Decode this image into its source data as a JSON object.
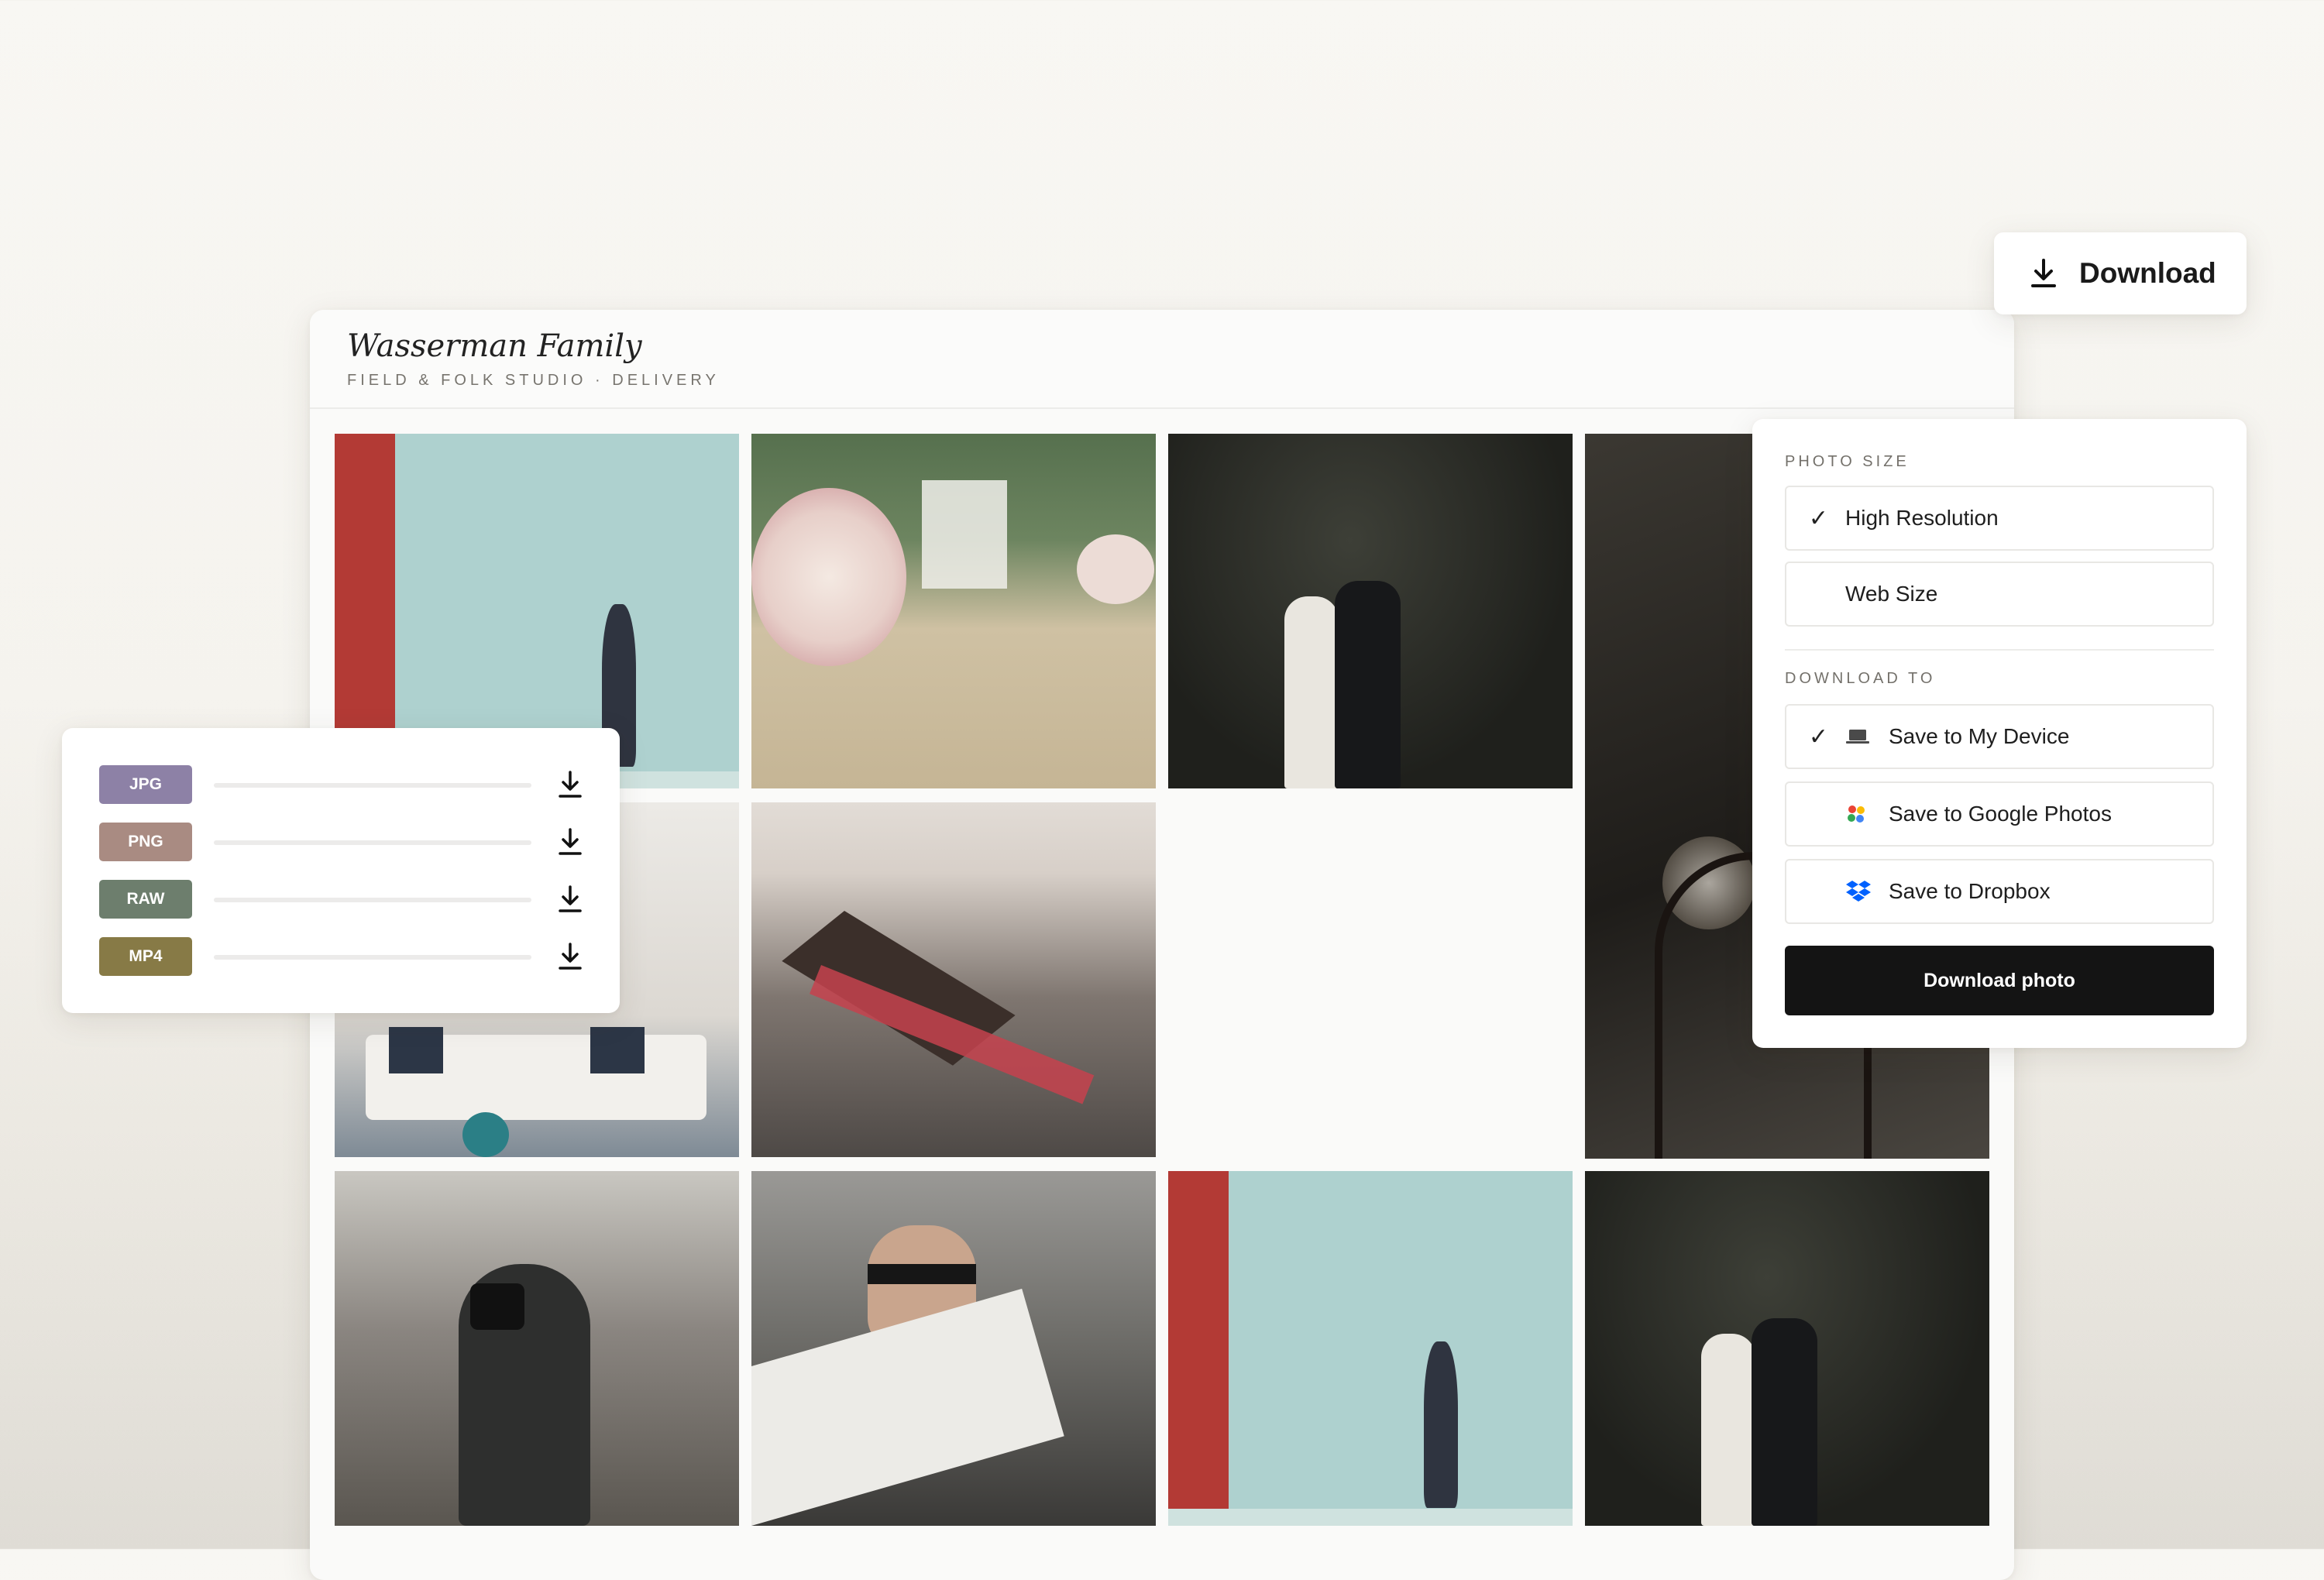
{
  "gallery": {
    "title": "Wasserman Family",
    "subtitle": "FIELD & FOLK STUDIO · DELIVERY",
    "photos": [
      {
        "subject": "woman lifting baby against teal wall"
      },
      {
        "subject": "wedding aisle with floral arrangements"
      },
      {
        "subject": "bride and groom under palm tree"
      },
      {
        "subject": "restaurant interior with bentwood chair"
      },
      {
        "subject": "living room with sofa and cushions"
      },
      {
        "subject": "long table set on beach"
      },
      {
        "subject": "photographer in city street"
      },
      {
        "subject": "man reading newspaper on balcony"
      },
      {
        "subject": "woman lifting baby against teal wall"
      },
      {
        "subject": "bride and groom under palm tree"
      }
    ]
  },
  "download_button": {
    "label": "Download",
    "icon": "download-icon"
  },
  "options": {
    "photo_size_label": "PHOTO SIZE",
    "sizes": [
      {
        "label": "High Resolution",
        "selected": true
      },
      {
        "label": "Web Size",
        "selected": false
      }
    ],
    "download_to_label": "DOWNLOAD TO",
    "destinations": [
      {
        "label": "Save to My Device",
        "icon": "laptop-icon",
        "selected": true
      },
      {
        "label": "Save to Google Photos",
        "icon": "google-photos-icon",
        "selected": false
      },
      {
        "label": "Save to Dropbox",
        "icon": "dropbox-icon",
        "selected": false
      }
    ],
    "submit_label": "Download photo",
    "check_glyph": "✓"
  },
  "formats": [
    {
      "label": "JPG",
      "color": "#8d81a6"
    },
    {
      "label": "PNG",
      "color": "#a98b82"
    },
    {
      "label": "RAW",
      "color": "#6d7e6d"
    },
    {
      "label": "MP4",
      "color": "#877a46"
    }
  ]
}
